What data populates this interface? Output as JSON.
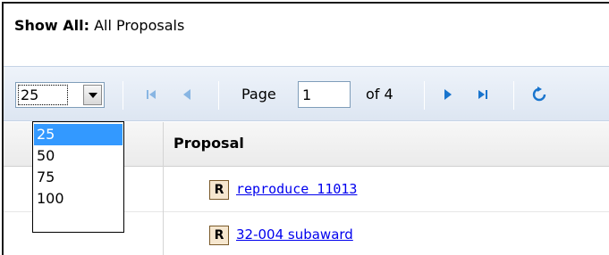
{
  "header": {
    "label": "Show All:",
    "value": "All Proposals"
  },
  "pager": {
    "page_size_selected": "25",
    "page_size_options": [
      "25",
      "50",
      "75",
      "100"
    ],
    "page_label": "Page",
    "current_page": "1",
    "of_label": "of 4",
    "icons": [
      "first-page-icon",
      "previous-page-icon",
      "next-page-icon",
      "last-page-icon",
      "refresh-icon"
    ]
  },
  "grid": {
    "column_header": "Proposal",
    "rows": [
      {
        "badge": "R",
        "link": "reproduce 11013"
      },
      {
        "badge": "R",
        "link": "32-004 subaward"
      }
    ]
  },
  "colors": {
    "link": "#0000ee",
    "selected_option": "#3399ff",
    "nav_enabled": "#1874cd",
    "nav_disabled": "#7fa7cf"
  }
}
